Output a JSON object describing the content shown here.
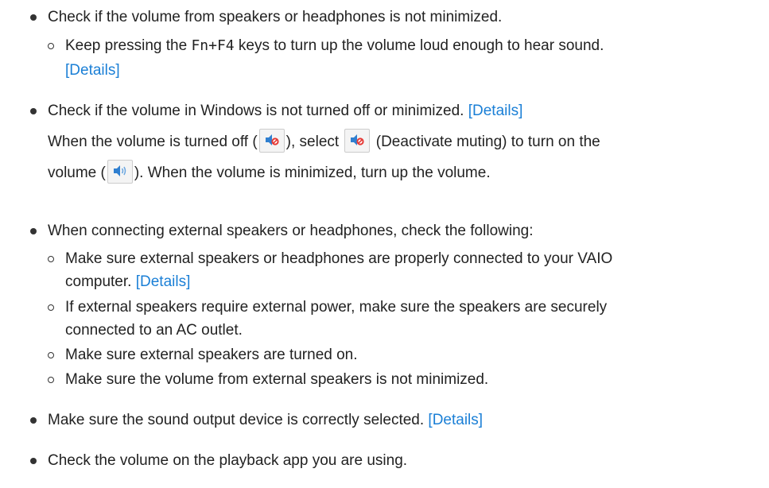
{
  "items": [
    {
      "text": "Check if the volume from speakers or headphones is not minimized.",
      "sub": [
        {
          "pre": "Keep pressing the ",
          "keys": "Fn+F4",
          "post": " keys to turn up the volume loud enough to hear sound.",
          "link": "[Details]"
        }
      ]
    },
    {
      "text": "Check if the volume in Windows is not turned off or minimized. ",
      "link": "[Details]",
      "cont1_a": "When the volume is turned off (",
      "cont1_b": "), select ",
      "cont1_c": " (Deactivate muting) to turn on the",
      "cont2_a": "volume (",
      "cont2_b": "). When the volume is minimized, turn up the volume."
    },
    {
      "text": "When connecting external speakers or headphones, check the following:",
      "sub": [
        {
          "line1": "Make sure external speakers or headphones are properly connected to your VAIO",
          "line2": "computer. ",
          "link": "[Details]"
        },
        {
          "line1": "If external speakers require external power, make sure the speakers are securely",
          "line2": "connected to an AC outlet."
        },
        {
          "line1": "Make sure external speakers are turned on."
        },
        {
          "line1": "Make sure the volume from external speakers is not minimized."
        }
      ]
    },
    {
      "text": "Make sure the sound output device is correctly selected. ",
      "link": "[Details]"
    },
    {
      "text": "Check the volume on the playback app you are using."
    }
  ],
  "icons": {
    "muted": "speaker-muted-icon",
    "unmuted": "speaker-unmuted-icon"
  },
  "colors": {
    "link": "#1a7fd6",
    "text": "#222222"
  }
}
